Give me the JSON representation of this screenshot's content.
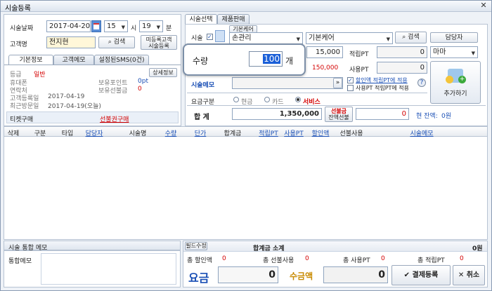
{
  "window": {
    "title": "시술등록",
    "close": "✕"
  },
  "customer": {
    "date_label": "시술날짜",
    "date_value": "2017-04-20",
    "hour": "15",
    "hour_unit": "시",
    "minute": "19",
    "minute_unit": "분",
    "name_label": "고객명",
    "name_value": "전지현",
    "search_label": "검색",
    "unreg_btn_line1": "미등록고객",
    "unreg_btn_line2": "시술등록"
  },
  "info_tabs": [
    "기본정보",
    "고객메모",
    "설정된SMS(0건)"
  ],
  "info": {
    "detail_btn": "상세정보",
    "grade_label": "등급",
    "grade_value": "일반",
    "phone_label": "휴대폰",
    "contact_label": "연락처",
    "point_label": "보유포인트",
    "point_value": "0pt",
    "prepaid_label": "보유선불금",
    "prepaid_value": "0",
    "reg_date_label": "고객등록일",
    "reg_date_value": "2017-04-19",
    "last_visit_label": "최근방문일",
    "last_visit_value": "2017-04-19(오늘)",
    "ticket_label": "티켓구매",
    "ticket_link": "선불권구매"
  },
  "svc_tabs": [
    "시술선택",
    "제품판매"
  ],
  "svc": {
    "treat_label": "시술",
    "category_caption": "기본케어",
    "category_value": "손관리",
    "item_value": "기본케어",
    "search_label": "검색",
    "staff_btn": "담당자",
    "staff_value": "마마",
    "price_value": "15,000",
    "price_sub": "150,000",
    "pt_label": "적립PT",
    "pt_value": "0",
    "use_pt_label": "사용PT",
    "use_pt_value": "0",
    "memo_label": "시술메모",
    "discount_link": "할인액 적립PT에 적용",
    "usept_check": "사용PT 적립PT에 적용",
    "add_btn": "추가하기",
    "pay_label": "요금구분",
    "pay_options": [
      "현금",
      "카드",
      "서비스"
    ],
    "total_label": "합   계",
    "total_value": "1,350,000",
    "prepaid_btn_line1": "선불금",
    "prepaid_btn_line2": "잔액선불",
    "prepaid_value": "0",
    "balance_label": "현 잔액:",
    "balance_value": "0원"
  },
  "qty_popup": {
    "label": "수량",
    "value": "100",
    "unit": "개"
  },
  "grid_headers": [
    "삭제",
    "구분",
    "타입",
    "담당자",
    "시술명",
    "수량",
    "단가",
    "합계금",
    "적립PT",
    "사용PT",
    "할인액",
    "선불사용",
    "시술메모"
  ],
  "bottom": {
    "memo_tab": "시술 통합 메모",
    "memo_label": "통합메모",
    "fix_btn": "필드수정",
    "subtotal_label": "합계금 소계",
    "subtotal_value": "0원",
    "sum_discount_label": "총 할인액",
    "sum_discount_value": "0",
    "sum_prepaid_label": "총 선불사용",
    "sum_prepaid_value": "0",
    "sum_usept_label": "총 사용PT",
    "sum_usept_value": "0",
    "sum_pt_label": "총 적립PT",
    "sum_pt_value": "0",
    "fee_label": "요금",
    "fee_value": "0",
    "received_label": "수금액",
    "received_value": "0",
    "confirm_btn": "결제등록",
    "cancel_btn": "취소"
  },
  "icons": [
    "calendar-icon",
    "search-icon",
    "check-icon",
    "close-icon",
    "help-icon",
    "add-item-icon"
  ]
}
